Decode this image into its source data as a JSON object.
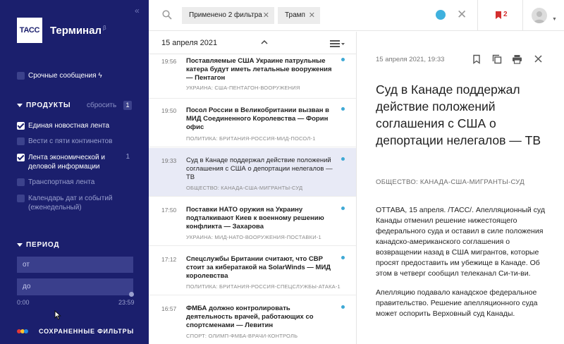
{
  "sidebar": {
    "brand_logo_text": "ТАСС",
    "brand_name": "Терминал",
    "brand_sup": "β",
    "urgent_label": "Срочные сообщения ϟ",
    "products": {
      "title": "ПРОДУКТЫ",
      "reset_label": "сбросить",
      "count": "1",
      "items": [
        {
          "label": "Единая новостная лента",
          "checked": true
        },
        {
          "label": "Вести с пяти континентов",
          "checked": false
        },
        {
          "label": "Лента экономической и деловой информации",
          "checked": true,
          "count": "1"
        },
        {
          "label": "Транспортная лента",
          "checked": false
        },
        {
          "label": "Календарь дат и событий (еженедельный)",
          "checked": false
        }
      ]
    },
    "period": {
      "title": "ПЕРИОД",
      "from_placeholder": "от",
      "to_placeholder": "до",
      "time_from": "0:00",
      "time_to": "23:59"
    },
    "saved_filters_label": "СОХРАНЕННЫЕ ФИЛЬТРЫ",
    "saved_dot_colors": [
      "#e53935",
      "#fbc02d",
      "#1e88e5"
    ]
  },
  "topbar": {
    "filter_chip_label": "Применено 2 фильтра",
    "query_chip_label": "Трамп",
    "live_color": "#3fb1de",
    "bookmark_count": "2"
  },
  "feed": {
    "date": "15 апреля 2021",
    "items": [
      {
        "time": "19:56",
        "title": "Поставляемые США Украине патрульные катера будут иметь летальные вооружения — Пентагон",
        "tags": "УКРАИНА: США-ПЕНТАГОН-ВООРУЖЕНИЯ"
      },
      {
        "time": "19:50",
        "title": "Посол России в Великобритании вызван в МИД Соединенного Королевства — Форин офис",
        "tags": "ПОЛИТИКА: БРИТАНИЯ-РОССИЯ-МИД-ПОСОЛ-1"
      },
      {
        "time": "19:33",
        "title": "Суд в Канаде поддержал действие положений соглашения с США о депортации нелегалов — ТВ",
        "tags": "ОБЩЕСТВО: КАНАДА-США-МИГРАНТЫ-СУД",
        "selected": true
      },
      {
        "time": "17:50",
        "title": "Поставки НАТО оружия на Украину подталкивают Киев к военному решению конфликта — Захарова",
        "tags": "УКРАИНА: МИД-НАТО-ВООРУЖЕНИЯ-ПОСТАВКИ-1"
      },
      {
        "time": "17:12",
        "title": "Спецслужбы Британии считают, что СВР стоит за кибератакой на SolarWinds — МИД королевства",
        "tags": "ПОЛИТИКА: БРИТАНИЯ-РОССИЯ-СПЕЦСЛУЖБЫ-АТАКА-1"
      },
      {
        "time": "16:57",
        "title": "ФМБА должно контролировать деятельность врачей, работающих со спортсменами — Левитин",
        "tags": "СПОРТ: ОЛИМП-ФМБА-ВРАЧИ-КОНТРОЛЬ"
      }
    ]
  },
  "article": {
    "datetime": "15 апреля 2021, 19:33",
    "title": "Суд в Канаде поддержал действие положений соглашения с США о депортации нелегалов — ТВ",
    "tags": "ОБЩЕСТВО: КАНАДА-США-МИГРАНТЫ-СУД",
    "paragraphs": [
      "ОТТАВА, 15 апреля. /ТАСС/. Апелляционный суд Канады отменил решение нижестоящего федерального суда и оставил в силе положения канадско-американского соглашения о возвращении назад в США мигрантов, которые просят предоставить им убежище в Канаде. Об этом в четверг сообщил телеканал Си-ти-ви.",
      "Апелляцию подавало канадское федеральное правительство. Решение апелляционного суда может оспорить Верховный суд Канады."
    ]
  }
}
